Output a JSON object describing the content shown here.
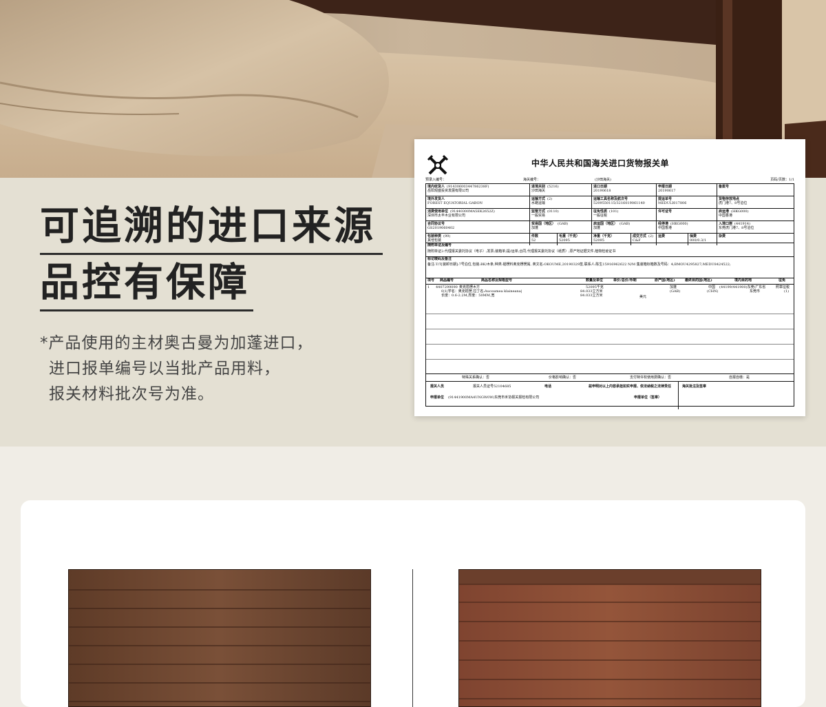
{
  "headline": {
    "line1": "可追溯的进口来源",
    "line2": "品控有保障"
  },
  "notes": {
    "line1": "*产品使用的主材奥古曼为加蓬进口，",
    "line2": "进口报单编号以当批产品用料，",
    "line3": "报关材料批次号为准。"
  },
  "doc": {
    "title": "中华人民共和国海关进口货物报关单",
    "pre_entry_label": "预录入编号：",
    "customs_no_label": "海关编号：",
    "port_bracket": "(沙田海关)",
    "page_label": "页码/页数：1/1",
    "r1": [
      {
        "label": "境内收货人",
        "value": "(91430600344786238F)",
        "value2": "岳阳观盛投资发展有限公司"
      },
      {
        "label": "进境关别",
        "value": "(5216)",
        "value2": "沙田海关"
      },
      {
        "label": "进口日期",
        "value": "",
        "value2": "20190618"
      },
      {
        "label": "申报日期",
        "value": "",
        "value2": "20190617"
      },
      {
        "label": "备案号",
        "value": "",
        "value2": ""
      }
    ],
    "r2": [
      {
        "label": "境外发货人",
        "value": "",
        "value2": "FOREST EQUATORIAL GABON"
      },
      {
        "label": "运输方式",
        "value": "(2)",
        "value2": "水路运输"
      },
      {
        "label": "运输工具名称及航次号",
        "value": "",
        "value2": "5209550115/3216019061140"
      },
      {
        "label": "提运单号",
        "value": "",
        "value2": "MEDULI017806"
      },
      {
        "label": "货物存放地点",
        "value": "",
        "value2": "虎门港7、8号泊位"
      }
    ],
    "r3": [
      {
        "label": "消费使用单位",
        "value": "(91440300MA5EK2652Z)",
        "value2": "深圳市太丰木业有限公司"
      },
      {
        "label": "监管方式",
        "value": "(0110)",
        "value2": "一般贸易"
      },
      {
        "label": "征免性质",
        "value": "(101)",
        "value2": "一般征税"
      },
      {
        "label": "许可证号",
        "value": "",
        "value2": ""
      },
      {
        "label": "启运港",
        "value": "(HKG000)",
        "value2": "中国香港"
      }
    ],
    "r4": [
      {
        "label": "合同协议号",
        "value": "",
        "value2": "GS2019060402"
      },
      {
        "label": "贸易国（地区）",
        "value": "(GAB)",
        "value2": "加蓬"
      },
      {
        "label": "启运国（地区）",
        "value": "(GAB)",
        "value2": "加蓬"
      },
      {
        "label": "经停港",
        "value": "(HKG000)",
        "value2": "中国香港"
      },
      {
        "label": "入境口岸",
        "value": "(441914)",
        "value2": "东莞虎门港7、8号泊位"
      }
    ],
    "r5": [
      {
        "label": "包装种类",
        "value": "(99)",
        "value2": "其他包装"
      },
      {
        "label": "件数",
        "value": "",
        "value2": "52"
      },
      {
        "label": "毛重（千克）",
        "value": "",
        "value2": "52095"
      },
      {
        "label": "净重（千克）",
        "value": "",
        "value2": "52095"
      },
      {
        "label": "成交方式",
        "value": "(2)",
        "value2": "C&F"
      },
      {
        "label": "运费",
        "value": "",
        "value2": ""
      },
      {
        "label": "保费",
        "value": "",
        "value2": "000/0.3/1"
      },
      {
        "label": "杂费",
        "value": "",
        "value2": ""
      }
    ],
    "docs_label": "随附单证及编号",
    "docs_text": "随附单证2:代理报关委托协议（电子）;发票;装箱单;提/运单;合同;代理报关委托协议（纸质）;原产地证据文件;植物检疫证书",
    "marks_label": "标记唛码及备注",
    "marks_text": "备注:T/T[装卸日期]:7号泊位,包装:BK/木条,种类:锯楞料奥克楞楞属, 英文名:OKOUME,20190329签,联系人:陈生15916962622 N/M   集装箱标箱数及号码：4;BMOU4295827;MEDU8424522;",
    "goods_headers": [
      "项号",
      "商品编号",
      "商品名称及规格型号",
      "数量及单位",
      "单价/总价/币制",
      "原产国(地区)",
      "最终目的国(地区)",
      "境内目的地",
      "征免"
    ],
    "goods_row": {
      "no": "1",
      "code": "4407299090",
      "name1": "奥克榄楞木方",
      "name2": "0|1|学名：奥克榄楞,拉丁名:Aucoumea klaineana|",
      "name3": "长度：0.6-2.2M,厚度：50MM,宽",
      "qty1": "52095千克",
      "qty2": "84.033立方米",
      "qty3": "84.033立方米",
      "currency": "美元",
      "origin1": "加蓬",
      "origin2": "(GAB)",
      "dest1": "中国",
      "dest2": "(CHN)",
      "domestic1": "(44199/441900)东莞/广东省",
      "domestic2": "东莞市",
      "levy1": "照章征税",
      "levy2": "(1)"
    },
    "confirm1": "特殊关系确认：否",
    "confirm2": "价格影响确认：否",
    "confirm3": "支付特许权使用费确认：否",
    "confirm4": "自报自缴：是",
    "declarant_label": "报关人员",
    "declarant_id_label": "报关人员证号52104685",
    "phone_label": "电话",
    "statement": "兹申明对以上内容承担如实申报、依法纳税之法律责任",
    "customs_remark": "海关批注及签章",
    "decl_unit_label": "申报单位",
    "decl_unit_value": "(91441900MA4UNGW0W)东莞市禾协报关报检有限公司",
    "decl_seal": "申报单位（签章）"
  },
  "colors": {
    "hero_bg": "#e4e0d3",
    "page_bg": "#f0ede6",
    "headline": "#222222",
    "wood_left": "#6c4630",
    "wood_right": "#8a4a33"
  }
}
